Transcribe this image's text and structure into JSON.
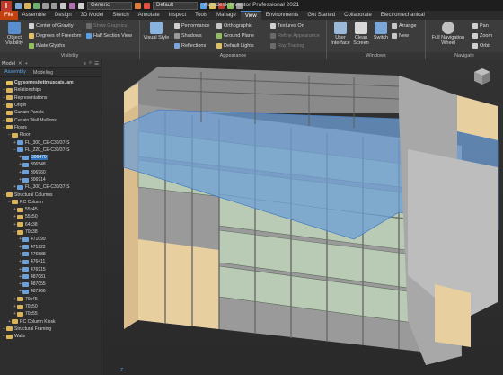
{
  "app": {
    "window_title": "Autodesk Inventor Professional 2021",
    "logo_letter": "I",
    "material_value": "Generic",
    "appearance_value": "Default"
  },
  "tabs": [
    "File",
    "Assemble",
    "Design",
    "3D Model",
    "Sketch",
    "Annotate",
    "Inspect",
    "Tools",
    "Manage",
    "View",
    "Environments",
    "Get Started",
    "Collaborate",
    "Electromechanical"
  ],
  "active_tab": "View",
  "ribbon": {
    "visibility": {
      "label": "Visibility",
      "object_visibility": "Object\nVisibility",
      "center_of_gravity": "Center of Gravity",
      "degrees_of_freedom": "Degrees of Freedom",
      "imate_glyphs": "iMate Glyphs",
      "show_graphics": "Show Graphics",
      "half_section_view": "Half Section View"
    },
    "appearance": {
      "label": "Appearance",
      "visual_style": "Visual Style",
      "performance": "Performance",
      "shadows": "Shadows",
      "reflections": "Reflections",
      "orthographic": "Orthographic",
      "ground_plane": "Ground Plane",
      "default_lights": "Default Lights",
      "textures_on": "Textures On",
      "refine_appearance": "Refine Appearance",
      "ray_tracing": "Ray Tracing"
    },
    "windows": {
      "label": "Windows",
      "user_interface": "User\nInterface",
      "clean_screen": "Clean\nScreen",
      "switch": "Switch",
      "arrange": "Arrange",
      "new": "New"
    },
    "navigate": {
      "label": "Navigate",
      "full_navigation_wheel": "Full Navigation\nWheel",
      "pan": "Pan",
      "zoom": "Zoom",
      "orbit": "Orbit"
    }
  },
  "browser": {
    "title": "Model",
    "tabs": [
      "Assembly",
      "Modeling"
    ],
    "nodes": [
      {
        "label": "Cgysonresitettmusdats.iam",
        "depth": 0,
        "icon": "root",
        "exp": "",
        "bold": true
      },
      {
        "label": "Relationships",
        "depth": 0,
        "icon": "folder",
        "exp": "+"
      },
      {
        "label": "Representations",
        "depth": 0,
        "icon": "folder",
        "exp": "+"
      },
      {
        "label": "Origin",
        "depth": 0,
        "icon": "folder",
        "exp": "+"
      },
      {
        "label": "Curtain Panels",
        "depth": 0,
        "icon": "folder",
        "exp": "+"
      },
      {
        "label": "Curtain Wall Mullions",
        "depth": 0,
        "icon": "folder",
        "exp": "+"
      },
      {
        "label": "Floors",
        "depth": 0,
        "icon": "folder",
        "exp": "−"
      },
      {
        "label": "Floor",
        "depth": 1,
        "icon": "folder",
        "exp": "−"
      },
      {
        "label": "FL_300_CE-C30/37-S",
        "depth": 2,
        "icon": "part",
        "exp": "+"
      },
      {
        "label": "FL_220_CE-C30/37-S",
        "depth": 2,
        "icon": "part",
        "exp": "−"
      },
      {
        "label": "306470",
        "depth": 3,
        "icon": "part",
        "exp": "+",
        "sel": true
      },
      {
        "label": "306548",
        "depth": 3,
        "icon": "part",
        "exp": "+"
      },
      {
        "label": "306960",
        "depth": 3,
        "icon": "part",
        "exp": "+"
      },
      {
        "label": "306914",
        "depth": 3,
        "icon": "part",
        "exp": "+"
      },
      {
        "label": "FL_300_CE-C30/37-S",
        "depth": 2,
        "icon": "part",
        "exp": "+"
      },
      {
        "label": "Structural Columns",
        "depth": 0,
        "icon": "folder",
        "exp": "−"
      },
      {
        "label": "RC Column",
        "depth": 1,
        "icon": "folder",
        "exp": "−"
      },
      {
        "label": "55x45",
        "depth": 2,
        "icon": "folder",
        "exp": "+"
      },
      {
        "label": "55x50",
        "depth": 2,
        "icon": "folder",
        "exp": "+"
      },
      {
        "label": "64x38",
        "depth": 2,
        "icon": "folder",
        "exp": "+"
      },
      {
        "label": "70x38",
        "depth": 2,
        "icon": "folder",
        "exp": "−"
      },
      {
        "label": "471099",
        "depth": 3,
        "icon": "part",
        "exp": "+"
      },
      {
        "label": "471222",
        "depth": 3,
        "icon": "part",
        "exp": "+"
      },
      {
        "label": "476588",
        "depth": 3,
        "icon": "part",
        "exp": "+"
      },
      {
        "label": "476411",
        "depth": 3,
        "icon": "part",
        "exp": "+"
      },
      {
        "label": "476915",
        "depth": 3,
        "icon": "part",
        "exp": "+"
      },
      {
        "label": "487081",
        "depth": 3,
        "icon": "part",
        "exp": "+"
      },
      {
        "label": "487055",
        "depth": 3,
        "icon": "part",
        "exp": "+"
      },
      {
        "label": "487266",
        "depth": 3,
        "icon": "part",
        "exp": "+"
      },
      {
        "label": "70x45",
        "depth": 2,
        "icon": "folder",
        "exp": "+"
      },
      {
        "label": "70x50",
        "depth": 2,
        "icon": "folder",
        "exp": "+"
      },
      {
        "label": "70x55",
        "depth": 2,
        "icon": "folder",
        "exp": "+"
      },
      {
        "label": "RC Column Kiosk",
        "depth": 1,
        "icon": "folder",
        "exp": "+"
      },
      {
        "label": "Structural Framing",
        "depth": 0,
        "icon": "folder",
        "exp": "+"
      },
      {
        "label": "Walls",
        "depth": 0,
        "icon": "folder",
        "exp": "+"
      }
    ]
  },
  "viewport": {
    "axis_label": "Z"
  },
  "colors": {
    "file_tab": "#c2410c",
    "accent": "#4a90d9",
    "floor_blue": "#6e9fd6",
    "wall_beige": "#e8cfa0"
  }
}
